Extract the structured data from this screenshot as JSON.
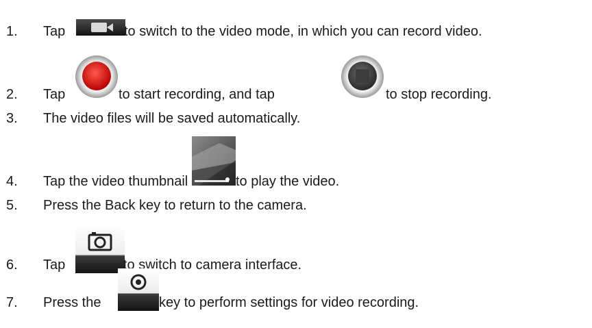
{
  "steps": [
    {
      "number": "1.",
      "before": "Tap",
      "after": "to switch to the video mode, in which you can record video.",
      "icon": "video-camera-icon"
    },
    {
      "number": "2.",
      "before": "Tap",
      "middle": "to start recording, and tap",
      "after": "to stop recording.",
      "icon": "record-icon",
      "icon2": "stop-icon"
    },
    {
      "number": "3.",
      "text": "The video files will be saved automatically."
    },
    {
      "number": "4.",
      "before": "Tap the video thumbnail",
      "after": "to play the video.",
      "icon": "video-thumbnail-icon"
    },
    {
      "number": "5.",
      "text": "Press the Back key to return to the camera."
    },
    {
      "number": "6.",
      "before": "Tap",
      "after": "to switch to camera interface.",
      "icon": "camera-icon"
    },
    {
      "number": "7.",
      "before": "Press the",
      "after": "key to perform settings for video recording.",
      "icon": "settings-icon"
    }
  ]
}
